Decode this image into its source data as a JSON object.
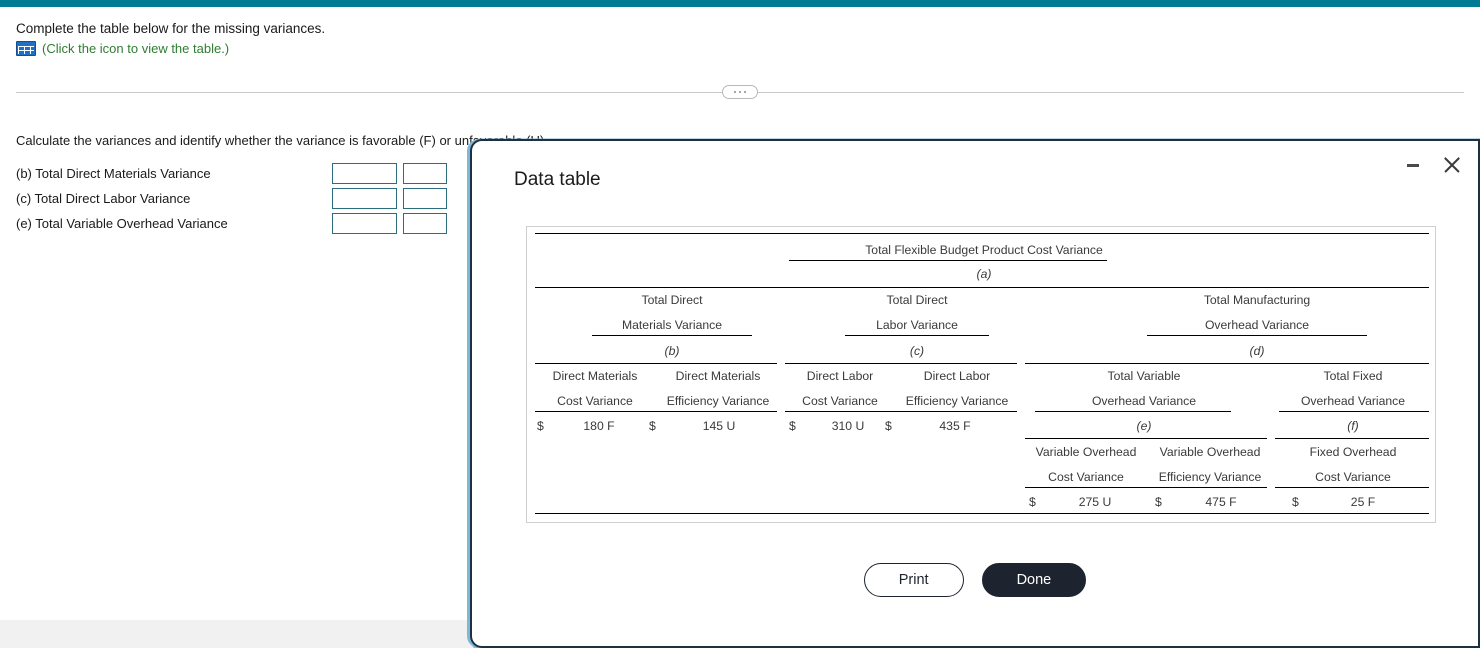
{
  "theme": {
    "topbar_color": "#007b94",
    "dialog_border": "#1d3040",
    "dialog_glow": "#7fb7d9",
    "link_green": "#2f7d32",
    "input_border": "#2c6e7f",
    "done_button_bg": "#1d2430"
  },
  "problem": {
    "instruction": "Complete the table below for the missing variances.",
    "icon_name": "table-grid-icon",
    "icon_caption": "(Click the icon to view the table.)",
    "calculate_prompt": "Calculate the variances and identify whether the variance is favorable (F) or unfavorable (U).",
    "answers": [
      {
        "label": "(b) Total Direct Materials Variance",
        "amount": "",
        "flag": ""
      },
      {
        "label": "(c) Total Direct Labor Variance",
        "amount": "",
        "flag": ""
      },
      {
        "label": "(e) Total Variable Overhead Variance",
        "amount": "",
        "flag": ""
      }
    ],
    "input_placeholder": ""
  },
  "dialog": {
    "title": "Data table",
    "minimize_label": "Minimize",
    "close_label": "Close",
    "buttons": {
      "print": "Print",
      "done": "Done"
    }
  },
  "table_data": {
    "type": "table",
    "title": "Total Flexible Budget Product Cost Variance",
    "level1": {
      "label": "Total Flexible Budget Product Cost Variance",
      "ref": "(a)",
      "value": ""
    },
    "level2": [
      {
        "line1": "Total Direct",
        "line2": "Materials Variance",
        "ref": "(b)",
        "value": ""
      },
      {
        "line1": "Total Direct",
        "line2": "Labor Variance",
        "ref": "(c)",
        "value": ""
      },
      {
        "line1": "Total Manufacturing",
        "line2": "Overhead Variance",
        "ref": "(d)",
        "value": ""
      }
    ],
    "level3": [
      {
        "line1": "Direct Materials",
        "line2": "Cost Variance",
        "currency": "$",
        "amount": "180 F"
      },
      {
        "line1": "Direct Materials",
        "line2": "Efficiency Variance",
        "currency": "$",
        "amount": "145 U"
      },
      {
        "line1": "Direct Labor",
        "line2": "Cost Variance",
        "currency": "$",
        "amount": "310 U"
      },
      {
        "line1": "Direct Labor",
        "line2": "Efficiency Variance",
        "currency": "$",
        "amount": "435 F"
      }
    ],
    "overhead_groups": [
      {
        "line1": "Total Variable",
        "line2": "Overhead Variance",
        "ref": "(e)",
        "value": ""
      },
      {
        "line1": "Total Fixed",
        "line2": "Overhead Variance",
        "ref": "(f)",
        "value": ""
      }
    ],
    "level4": [
      {
        "line1": "Variable Overhead",
        "line2": "Cost Variance",
        "currency": "$",
        "amount": "275 U"
      },
      {
        "line1": "Variable Overhead",
        "line2": "Efficiency Variance",
        "currency": "$",
        "amount": "475 F"
      },
      {
        "line1": "Fixed Overhead",
        "line2": "Cost Variance",
        "currency": "$",
        "amount": "25 F"
      }
    ]
  }
}
